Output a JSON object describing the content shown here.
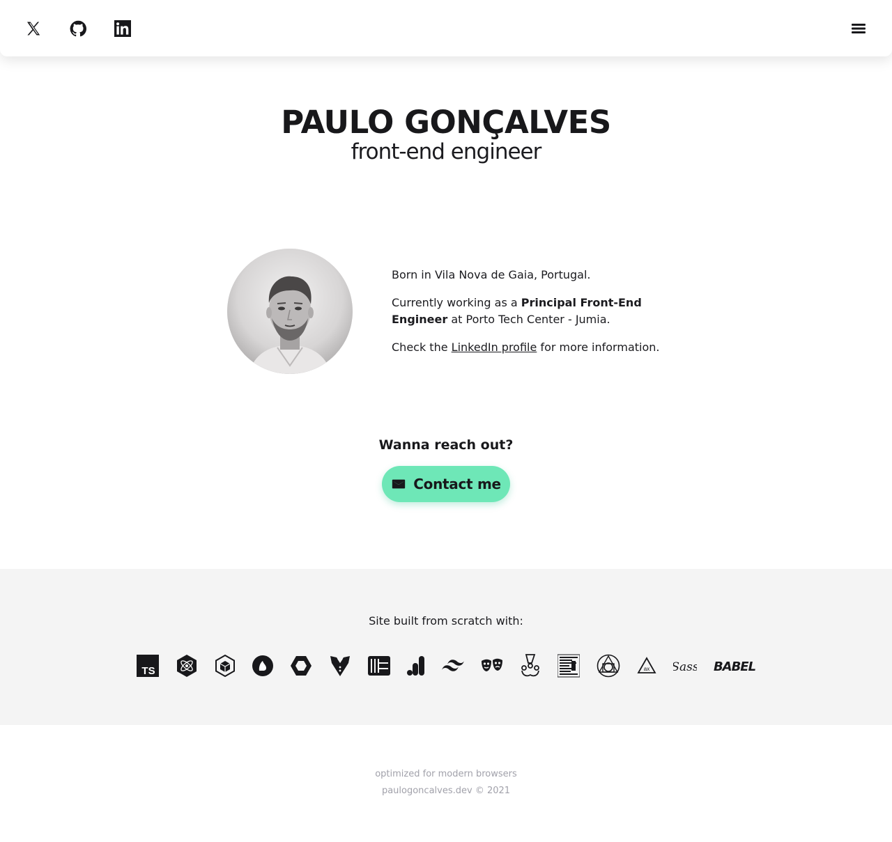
{
  "header": {
    "socials": [
      {
        "icon": "twitter-x-icon",
        "label": "Twitter"
      },
      {
        "icon": "github-icon",
        "label": "GitHub"
      },
      {
        "icon": "linkedin-icon",
        "label": "LinkedIn"
      }
    ],
    "menu_icon": "hamburger-menu-icon"
  },
  "hero": {
    "name": "PAULO GONÇALVES",
    "role": "front-end engineer"
  },
  "about": {
    "born": "Born in Vila Nova de Gaia, Portugal.",
    "work_prefix": "Currently working as a ",
    "work_title": "Principal Front-End Engineer",
    "work_suffix": " at Porto Tech Center - Jumia.",
    "check_prefix": "Check the ",
    "check_link": "LinkedIn profile",
    "check_suffix": " for more information."
  },
  "contact": {
    "question": "Wanna reach out?",
    "button_label": "Contact me",
    "accent": "#6ee7b7"
  },
  "built_with": {
    "title": "Site built from scratch with:",
    "tech_icons": [
      "typescript-icon",
      "preact-icon",
      "webpack-icon",
      "stencil-icon",
      "eslint-icon",
      "prettier-icon",
      "lerna-icon",
      "google-analytics-icon",
      "tailwind-icon",
      "playwright-icon",
      "jest-icon",
      "jsdoc-icon",
      "workbox-icon",
      "axe-icon",
      "sass-icon",
      "babel-icon"
    ],
    "sass_text": "Sass",
    "babel_text": "BABEL",
    "ts_text": "TS",
    "ax_text": "ax",
    "background": "#f4f4f4"
  },
  "footer": {
    "line1": "optimized for modern browsers",
    "line2": "paulogoncalves.dev © 2021"
  }
}
